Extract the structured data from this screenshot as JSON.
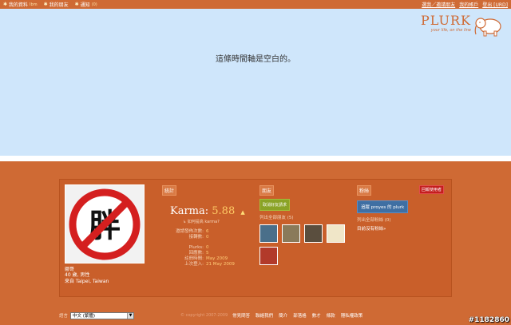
{
  "topbar": {
    "items": [
      {
        "label": "我的資料",
        "badge": "Ibm"
      },
      {
        "label": "我的朋友",
        "badge": ""
      },
      {
        "label": "通知",
        "badge": "(0)"
      }
    ],
    "right_links": [
      "選我／邀請朋友",
      "我的帳戶",
      "登出 [URD]"
    ]
  },
  "logo": {
    "name": "PLURK",
    "tagline": "your life, on the line"
  },
  "timeline": {
    "empty_message": "這條時間軸是空白的。"
  },
  "profile": {
    "avatar_text": "胖",
    "name": "娜哥",
    "line1": "40 歲, 男性",
    "line2": "來自 Taipei, Taiwan"
  },
  "stats": {
    "header": "統計",
    "karma_label": "Karma:",
    "karma_value": "5.88",
    "karma_link": "如何提高 karma?",
    "rows": [
      {
        "k": "邀請發佈次數:",
        "v": "6"
      },
      {
        "k": "接轉數:",
        "v": "0"
      }
    ],
    "rows2": [
      {
        "k": "Plurks:",
        "v": "0"
      },
      {
        "k": "回應數:",
        "v": "5"
      },
      {
        "k": "註冊時間:",
        "v": "May 2009"
      },
      {
        "k": "上次登入:",
        "v": "21 May 2009"
      }
    ]
  },
  "friends": {
    "header": "朋友",
    "button": "取消好友請求",
    "list_all": "列出全部朋友 (5)",
    "thumb_colors": [
      "#4a6f8a",
      "#8a7a5a",
      "#5a4e3e",
      "#f0e6c8",
      "#b23a2a"
    ]
  },
  "fans": {
    "header": "粉絲",
    "guide_button": "回報使用者",
    "follow_button": "追蹤 proyes 的 plurk",
    "list_all": "列出全部粉絲 (0)",
    "no_fans": "目前沒有粉絲»"
  },
  "footer": {
    "lang_label": "語言",
    "lang_value": "中文 (繁體)",
    "copyright": "© copyright 2007-2009",
    "links": [
      "常見問答",
      "聯絡我們",
      "簡介",
      "部落格",
      "數才",
      "條款",
      "隱私權政策"
    ]
  },
  "watermark": "#1182860",
  "colors": {
    "accent": "#cf6a34",
    "timeline_bg": "#cfe6fb"
  }
}
